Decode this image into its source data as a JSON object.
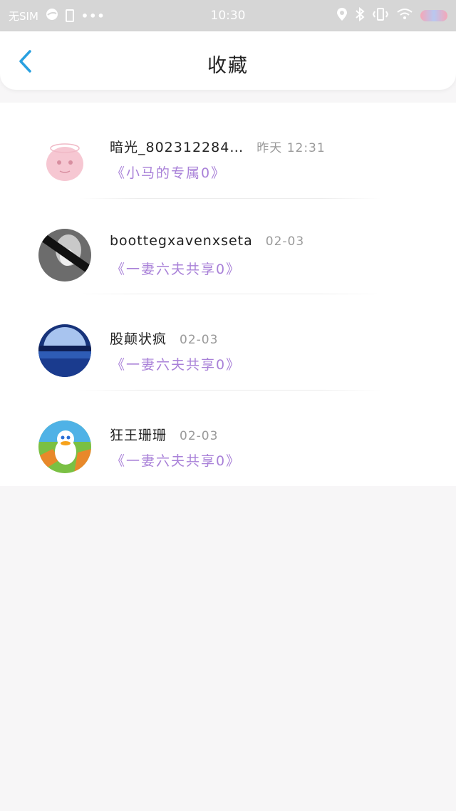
{
  "status_bar": {
    "carrier": "无SIM",
    "time": "10:30",
    "more": "•••"
  },
  "header": {
    "title": "收藏"
  },
  "favorites": [
    {
      "name": "暗光_802312284…",
      "time": "昨天  12:31",
      "book": "《小马的专属0》"
    },
    {
      "name": "boottegxavenxseta",
      "time": "02-03",
      "book": "《一妻六夫共享0》"
    },
    {
      "name": "股颠状疯",
      "time": "02-03",
      "book": "《一妻六夫共享0》"
    },
    {
      "name": "狂王珊珊",
      "time": "02-03",
      "book": "《一妻六夫共享0》"
    }
  ],
  "colors": {
    "accent": "#29a0e0",
    "link": "#a981d8"
  }
}
